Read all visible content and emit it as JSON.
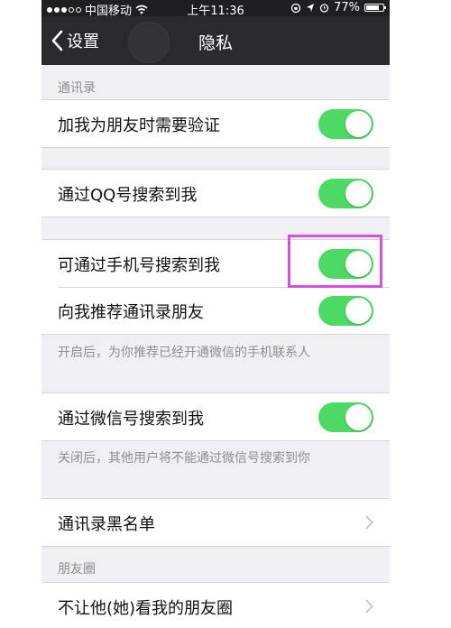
{
  "status_bar": {
    "carrier": "中国移动",
    "time": "上午11:36",
    "battery": "77%",
    "battery_level": 0.77
  },
  "nav": {
    "back_label": "设置",
    "title": "隐私"
  },
  "sections": {
    "contacts_header": "通讯录",
    "moments_header": "朋友圈"
  },
  "rows": {
    "verify_friend": {
      "label": "加我为朋友时需要验证",
      "on": true
    },
    "search_qq": {
      "label": "通过QQ号搜索到我",
      "on": true
    },
    "search_phone": {
      "label": "可通过手机号搜索到我",
      "on": true
    },
    "recommend_contacts": {
      "label": "向我推荐通讯录朋友",
      "on": true
    },
    "search_wechat_id": {
      "label": "通过微信号搜索到我",
      "on": true
    },
    "blacklist": {
      "label": "通讯录黑名单"
    },
    "hide_moments": {
      "label": "不让他(她)看我的朋友圈"
    }
  },
  "notes": {
    "recommend_note": "开启后，为你推荐已经开通微信的手机联系人",
    "wechat_id_note": "关闭后，其他用户将不能通过微信号搜索到你"
  },
  "colors": {
    "toggle_on": "#4cd964",
    "highlight": "#d84ee0",
    "nav_background": "#2a2a2d"
  }
}
